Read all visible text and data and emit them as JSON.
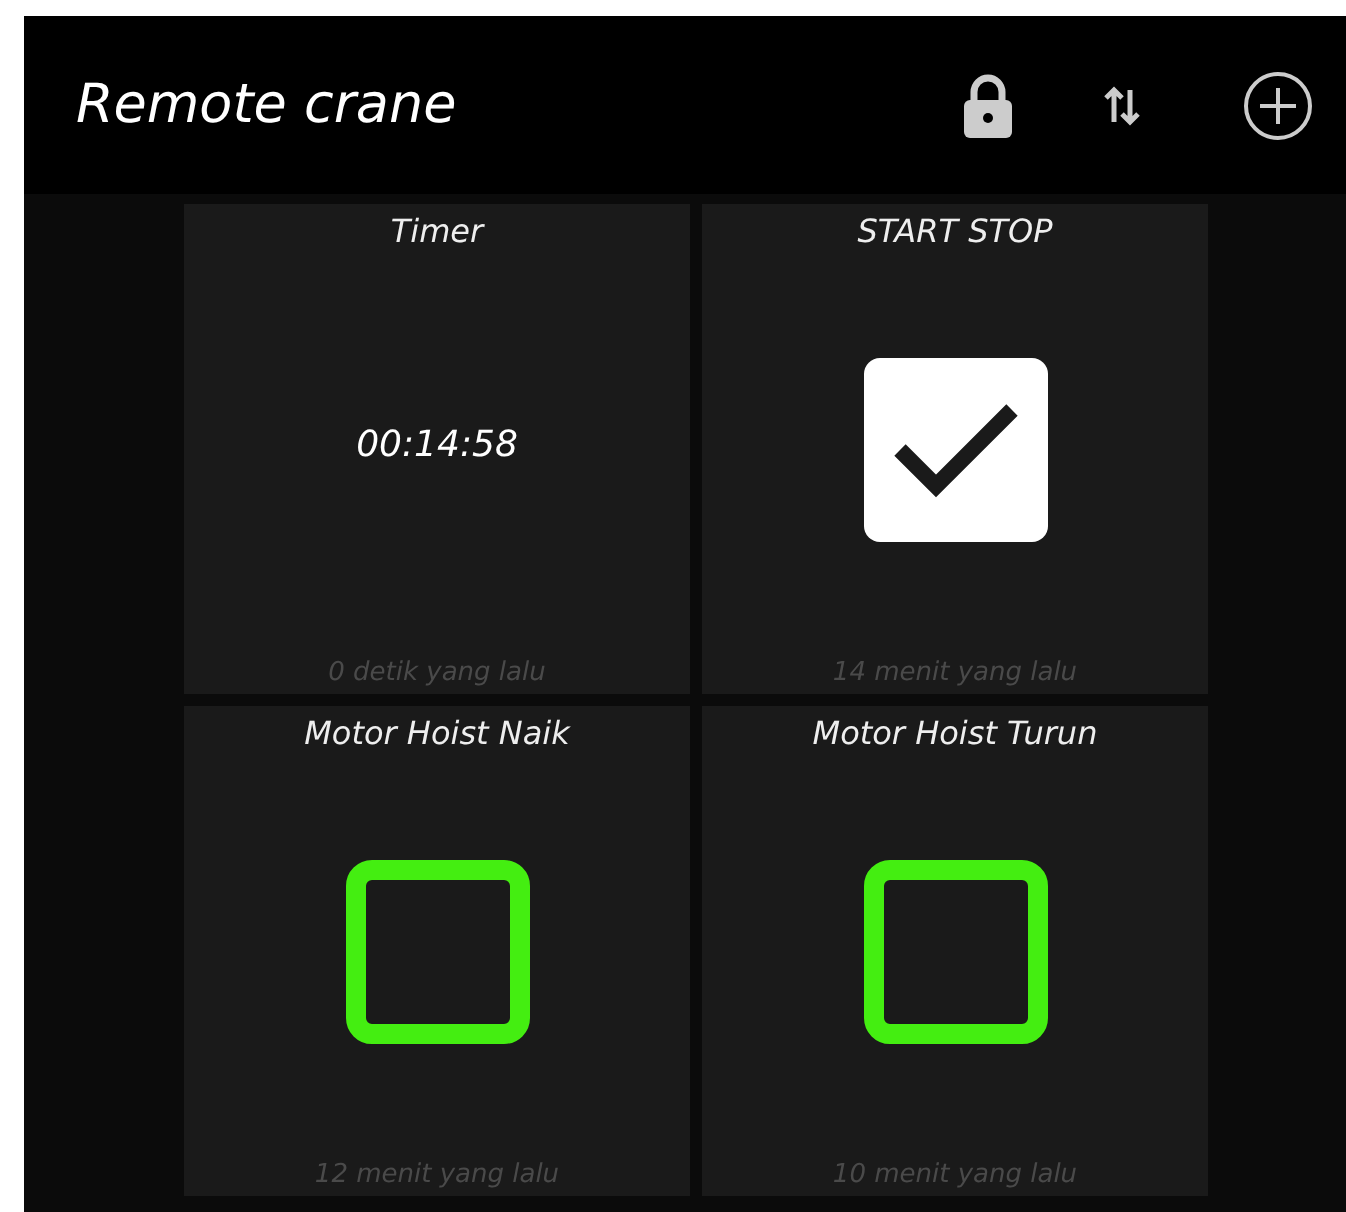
{
  "app_bar": {
    "title": "Remote crane"
  },
  "widgets": [
    {
      "kind": "timer",
      "title": "Timer",
      "value": "00:14:58",
      "updated": "0 detik yang lalu"
    },
    {
      "kind": "checkbox",
      "title": "START STOP",
      "checked": true,
      "updated": "14 menit yang lalu"
    },
    {
      "kind": "checkbox",
      "title": "Motor Hoist Naik",
      "checked": false,
      "updated": "12 menit yang lalu"
    },
    {
      "kind": "checkbox",
      "title": "Motor Hoist Turun",
      "checked": false,
      "updated": "10 menit yang lalu"
    }
  ]
}
